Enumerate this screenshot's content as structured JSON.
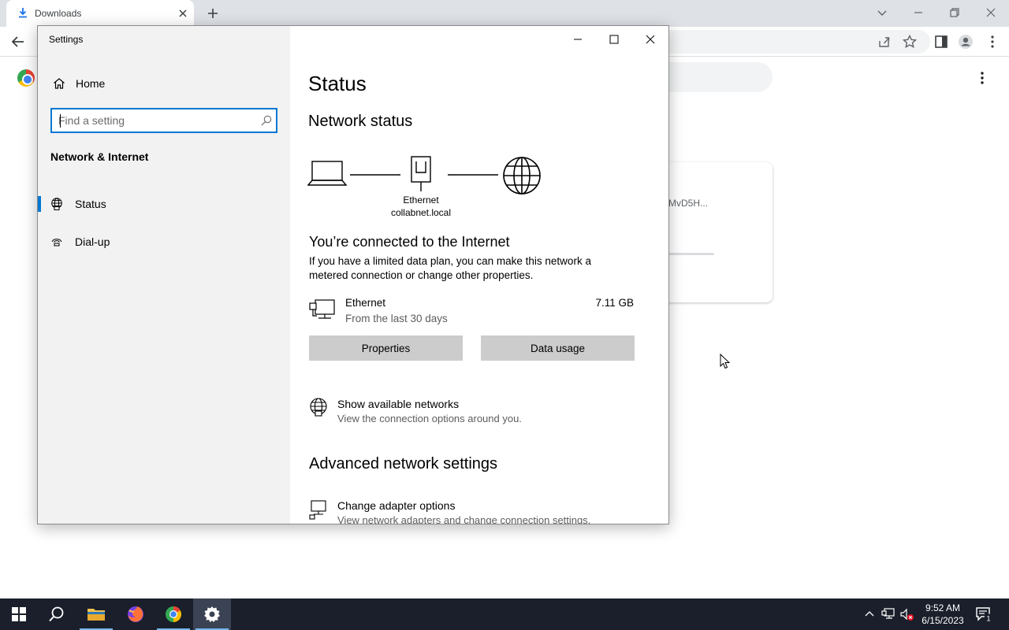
{
  "browser": {
    "tab_title": "Downloads",
    "download_filename": "MvD5H..."
  },
  "settings": {
    "window_title": "Settings",
    "sidebar": {
      "home_label": "Home",
      "search_placeholder": "Find a setting",
      "section_title": "Network & Internet",
      "items": [
        {
          "label": "Status",
          "icon": "ethernet-globe-icon",
          "selected": true
        },
        {
          "label": "Dial-up",
          "icon": "dialup-icon",
          "selected": false
        }
      ]
    },
    "main": {
      "page_title": "Status",
      "network_status_heading": "Network status",
      "diagram": {
        "adapter_name": "Ethernet",
        "domain": "collabnet.local"
      },
      "connected_title": "You’re connected to the Internet",
      "connected_desc": "If you have a limited data plan, you can make this network a metered connection or change other properties.",
      "ethernet": {
        "name": "Ethernet",
        "period": "From the last 30 days",
        "usage": "7.11 GB"
      },
      "buttons": {
        "properties": "Properties",
        "data_usage": "Data usage"
      },
      "show_networks": {
        "title": "Show available networks",
        "desc": "View the connection options around you."
      },
      "advanced_heading": "Advanced network settings",
      "adapter_options": {
        "title": "Change adapter options",
        "desc": "View network adapters and change connection settings."
      }
    }
  },
  "taskbar": {
    "time": "9:52 AM",
    "date": "6/15/2023",
    "notification_count": "1",
    "accent_color": "#76b9ed"
  }
}
